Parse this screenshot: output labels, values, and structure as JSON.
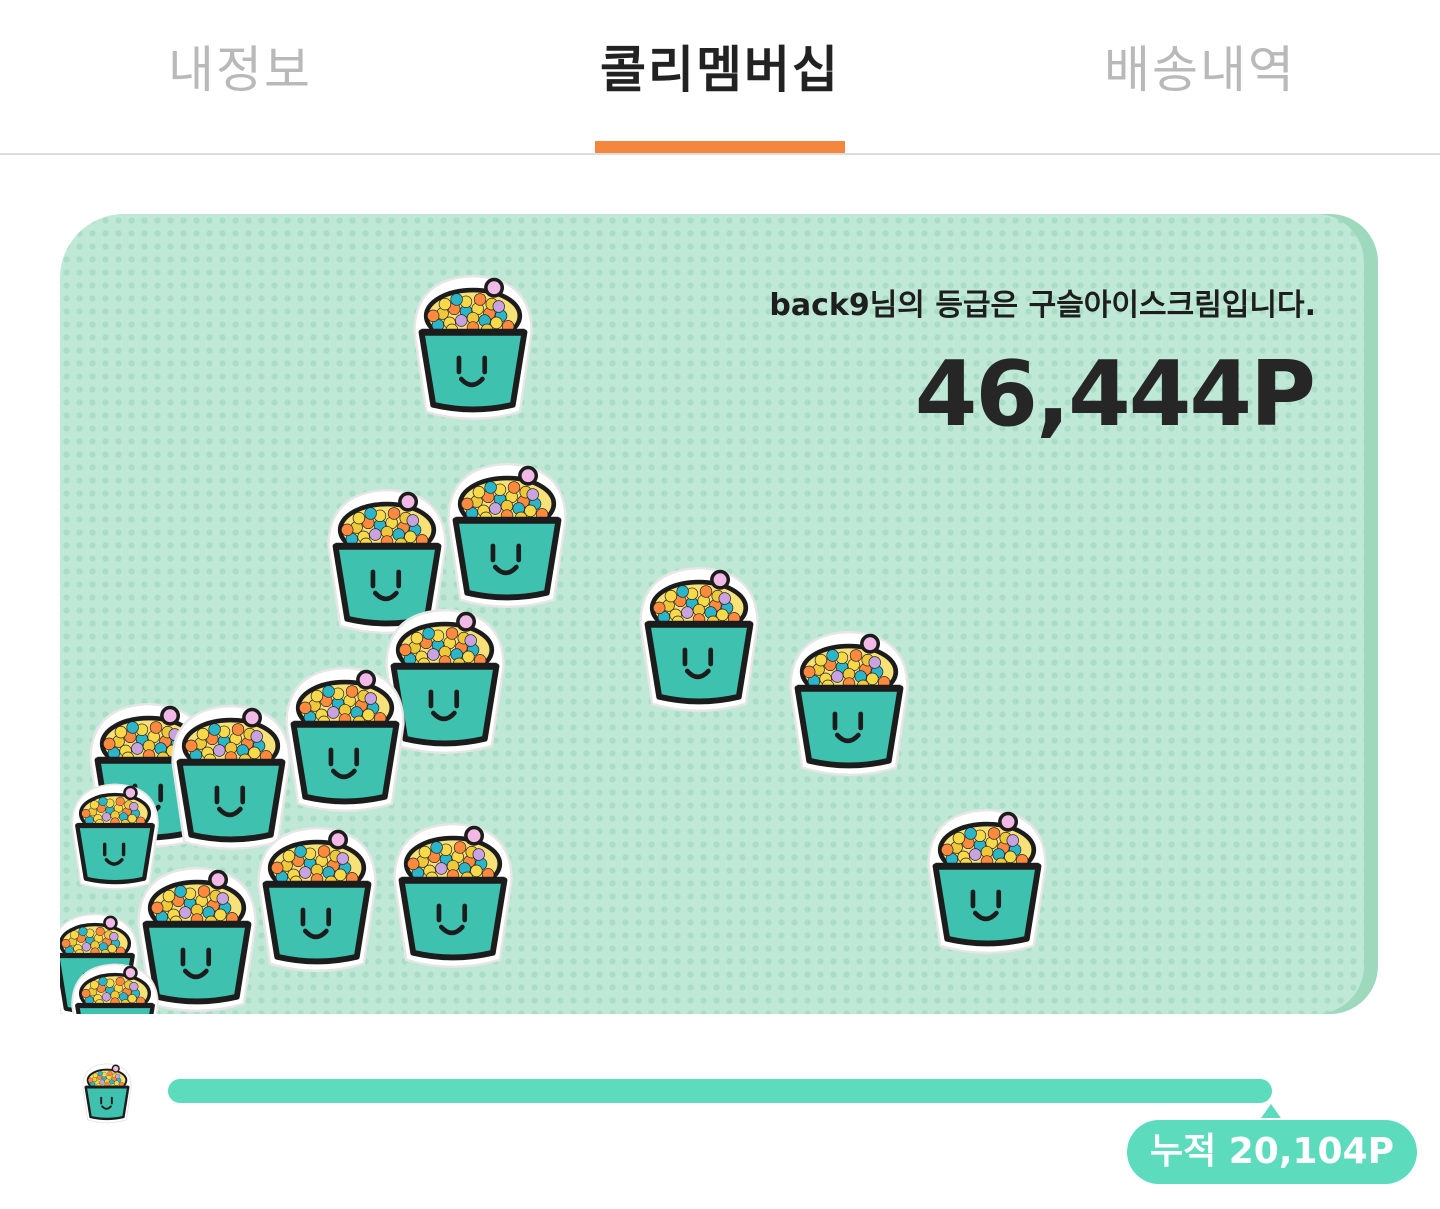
{
  "tabs": [
    {
      "label": "내정보",
      "active": false
    },
    {
      "label": "콜리멤버십",
      "active": true
    },
    {
      "label": "배송내역",
      "active": false
    }
  ],
  "membership": {
    "grade_message": "back9님의 등급은 구슬아이스크림입니다.",
    "points": "46,444P",
    "grade_icon": "bead-icecream-cup-icon"
  },
  "progress": {
    "accumulated_label": "누적 20,104P",
    "fill_fraction": 1.0
  },
  "colors": {
    "accent": "#f2873d",
    "progress": "#5ddcbd",
    "card_bg": "#bfe9d6",
    "cup": "#3fc1b0"
  }
}
